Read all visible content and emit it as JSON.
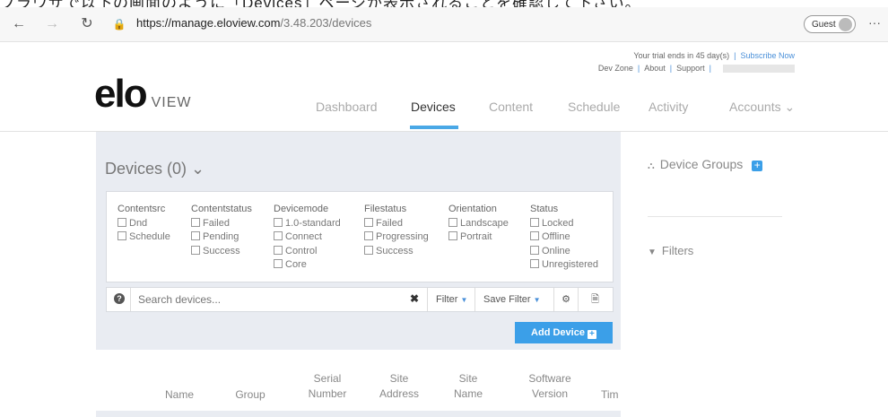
{
  "top_banner": "ブラウザで以下の画面のように「Devices」ページが表示されることを確認して下さい。",
  "browser": {
    "back_icon": "←",
    "forward_icon": "→",
    "refresh_icon": "↻",
    "lock_icon": "🔒",
    "url_domain": "https://manage.eloview.com",
    "url_path": "/3.48.203/devices",
    "guest_label": "Guest",
    "more_icon": "···"
  },
  "header": {
    "trial_text": "Your trial ends in 45 day(s)",
    "subscribe_link": "Subscribe Now",
    "links": [
      "Dev Zone",
      "About",
      "Support"
    ],
    "logo_brand": "elo",
    "logo_suffix": "VIEW",
    "nav": [
      "Dashboard",
      "Devices",
      "Content",
      "Schedule",
      "Activity",
      "Accounts ⌄"
    ],
    "active_nav": "Devices"
  },
  "devices": {
    "title": "Devices (0) ⌄",
    "filter_columns": [
      {
        "header": "Contentsrc",
        "options": [
          "Dnd",
          "Schedule"
        ]
      },
      {
        "header": "Contentstatus",
        "options": [
          "Failed",
          "Pending",
          "Success"
        ]
      },
      {
        "header": "Devicemode",
        "options": [
          "1.0-standard",
          "Connect",
          "Control",
          "Core"
        ]
      },
      {
        "header": "Filestatus",
        "options": [
          "Failed",
          "Progressing",
          "Success"
        ]
      },
      {
        "header": "Orientation",
        "options": [
          "Landscape",
          "Portrait"
        ]
      },
      {
        "header": "Status",
        "options": [
          "Locked",
          "Offline",
          "Online",
          "Unregistered"
        ]
      }
    ],
    "search_placeholder": "Search devices...",
    "clear_icon": "✖",
    "filter_label": "Filter",
    "save_filter_label": "Save Filter",
    "gear_icon": "⚙",
    "export_icon": "🗎",
    "add_device_label": "Add Device",
    "table_headers": [
      "Name",
      "Group",
      "Serial\nNumber",
      "Site\nAddress",
      "Site\nName",
      "Software\nVersion",
      "Tim"
    ]
  },
  "sidebar": {
    "device_groups_label": "Device Groups",
    "filters_label": "Filters"
  },
  "colors": {
    "accent": "#3b9fe8",
    "panel_bg": "#e9ecf2"
  }
}
